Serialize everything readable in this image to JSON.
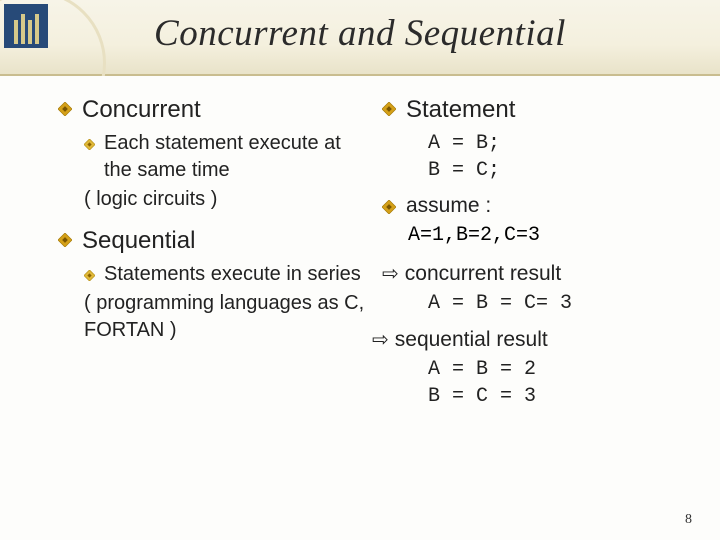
{
  "title": "Concurrent and Sequential",
  "left": {
    "concurrent": {
      "heading": "Concurrent",
      "sub1": "Each statement execute at the same time",
      "sub2": "( logic circuits )"
    },
    "sequential": {
      "heading": "Sequential",
      "sub1": "Statements execute in series",
      "sub2": "( programming languages as C, FORTAN )"
    }
  },
  "right": {
    "statement": {
      "heading": "Statement",
      "code1": "A = B;",
      "code2": "B = C;"
    },
    "assume": {
      "heading": "assume :",
      "code": "A=1,B=2,C=3"
    },
    "concurrent_result": {
      "label": "concurrent result",
      "code": "A = B = C= 3"
    },
    "sequential_result": {
      "label": "sequential result",
      "code1": "A = B = 2",
      "code2": "B = C = 3"
    }
  },
  "page_number": "8"
}
